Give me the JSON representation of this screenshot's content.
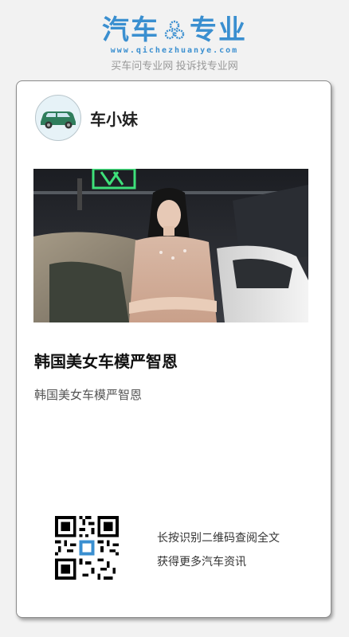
{
  "header": {
    "logo_left": "汽车",
    "logo_right": "专业",
    "url": "www.qichezhuanye.com",
    "tagline": "买车问专业网 投诉找专业网",
    "brand_color": "#3a8fd0"
  },
  "card": {
    "author": "车小妹",
    "avatar_icon": "car-icon",
    "title": "韩国美女车模严智恩",
    "description": "韩国美女车模严智恩",
    "qr_hint_line1": "长按识别二维码查阅全文",
    "qr_hint_line2": "获得更多汽车资讯"
  }
}
